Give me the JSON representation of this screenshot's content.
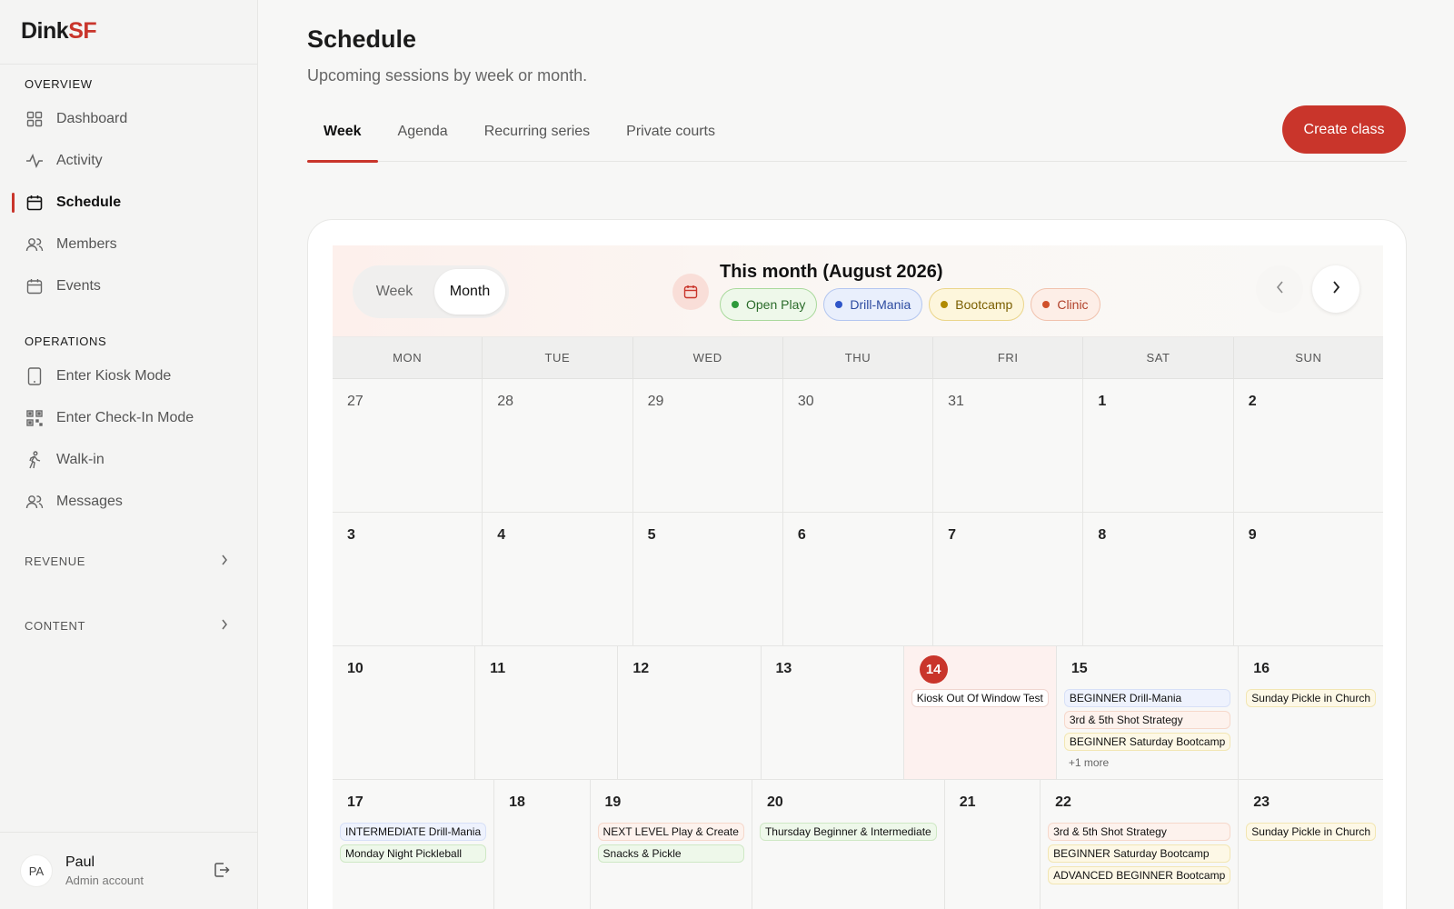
{
  "brand": {
    "part1": "Dink",
    "part2": "SF"
  },
  "sidebar": {
    "overview_label": "OVERVIEW",
    "overview_items": [
      {
        "label": "Dashboard",
        "icon": "grid-icon"
      },
      {
        "label": "Activity",
        "icon": "activity-icon"
      },
      {
        "label": "Schedule",
        "icon": "calendar-icon"
      },
      {
        "label": "Members",
        "icon": "users-icon"
      },
      {
        "label": "Events",
        "icon": "calendar-icon"
      }
    ],
    "operations_label": "OPERATIONS",
    "operations_items": [
      {
        "label": "Enter Kiosk Mode",
        "icon": "tablet-icon"
      },
      {
        "label": "Enter Check-In Mode",
        "icon": "qr-code-icon"
      },
      {
        "label": "Walk-in",
        "icon": "walking-icon"
      },
      {
        "label": "Messages",
        "icon": "users-icon"
      }
    ],
    "revenue_label": "REVENUE",
    "content_label": "CONTENT"
  },
  "user": {
    "initials": "PA",
    "name": "Paul",
    "role": "Admin account"
  },
  "page": {
    "title": "Schedule",
    "subtitle": "Upcoming sessions by week or month.",
    "tabs": [
      "Week",
      "Agenda",
      "Recurring series",
      "Private courts"
    ],
    "active_tab": "Week",
    "create_label": "Create class"
  },
  "calendar": {
    "toggle": {
      "week": "Week",
      "month": "Month",
      "selected": "Month"
    },
    "month_title": "This month (August 2026)",
    "legend": [
      {
        "label": "Open Play",
        "dot": "#2e9a3c",
        "bg": "#eef8ea",
        "border": "#a9d99c",
        "text": "#2a6b2a"
      },
      {
        "label": "Drill-Mania",
        "dot": "#2f56c9",
        "bg": "#e9effc",
        "border": "#b3c6f0",
        "text": "#2c4aa0"
      },
      {
        "label": "Bootcamp",
        "dot": "#b08a00",
        "bg": "#fdf6dc",
        "border": "#ebd58a",
        "text": "#7a5e00"
      },
      {
        "label": "Clinic",
        "dot": "#d0502a",
        "bg": "#fdeee7",
        "border": "#f1c2ad",
        "text": "#b1412a"
      }
    ],
    "weekdays": [
      "MON",
      "TUE",
      "WED",
      "THU",
      "FRI",
      "SAT",
      "SUN"
    ],
    "weeks": [
      [
        {
          "num": "27",
          "muted": true,
          "events": []
        },
        {
          "num": "28",
          "muted": true,
          "events": []
        },
        {
          "num": "29",
          "muted": true,
          "events": []
        },
        {
          "num": "30",
          "muted": true,
          "events": []
        },
        {
          "num": "31",
          "muted": true,
          "events": []
        },
        {
          "num": "1",
          "events": []
        },
        {
          "num": "2",
          "events": []
        }
      ],
      [
        {
          "num": "3",
          "events": []
        },
        {
          "num": "4",
          "events": []
        },
        {
          "num": "5",
          "events": []
        },
        {
          "num": "6",
          "events": []
        },
        {
          "num": "7",
          "events": []
        },
        {
          "num": "8",
          "events": []
        },
        {
          "num": "9",
          "events": []
        }
      ],
      [
        {
          "num": "10",
          "events": []
        },
        {
          "num": "11",
          "events": []
        },
        {
          "num": "12",
          "events": []
        },
        {
          "num": "13",
          "events": []
        },
        {
          "num": "14",
          "today": true,
          "events": [
            {
              "title": "Kiosk Out Of Window Test",
              "kind": "today-ev"
            }
          ]
        },
        {
          "num": "15",
          "events": [
            {
              "title": "BEGINNER Drill-Mania",
              "kind": "drill"
            },
            {
              "title": "3rd & 5th Shot Strategy",
              "kind": "clinic"
            },
            {
              "title": "BEGINNER Saturday Bootcamp",
              "kind": "boot"
            }
          ],
          "more": "+1 more"
        },
        {
          "num": "16",
          "events": [
            {
              "title": "Sunday Pickle in Church",
              "kind": "boot"
            }
          ]
        }
      ],
      [
        {
          "num": "17",
          "events": [
            {
              "title": "INTERMEDIATE Drill-Mania",
              "kind": "drill"
            },
            {
              "title": "Monday Night Pickleball",
              "kind": "open"
            }
          ]
        },
        {
          "num": "18",
          "events": []
        },
        {
          "num": "19",
          "events": [
            {
              "title": "NEXT LEVEL Play & Create",
              "kind": "clinic"
            },
            {
              "title": "Snacks & Pickle",
              "kind": "open"
            }
          ]
        },
        {
          "num": "20",
          "events": [
            {
              "title": "Thursday Beginner & Intermediate",
              "kind": "open"
            }
          ]
        },
        {
          "num": "21",
          "events": []
        },
        {
          "num": "22",
          "events": [
            {
              "title": "3rd & 5th Shot Strategy",
              "kind": "clinic"
            },
            {
              "title": "BEGINNER Saturday Bootcamp",
              "kind": "boot"
            },
            {
              "title": "ADVANCED BEGINNER Bootcamp",
              "kind": "boot"
            }
          ]
        },
        {
          "num": "23",
          "events": [
            {
              "title": "Sunday Pickle in Church",
              "kind": "boot"
            }
          ]
        }
      ]
    ]
  }
}
